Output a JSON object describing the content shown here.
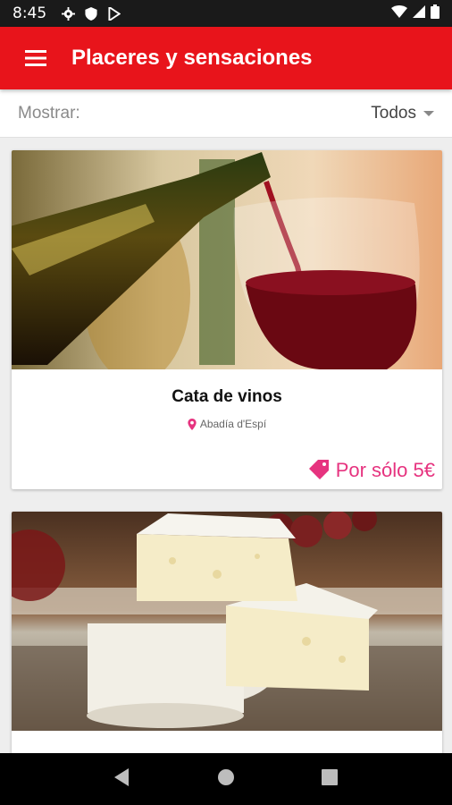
{
  "status_bar": {
    "time": "8:45"
  },
  "app_bar": {
    "title": "Placeres y sensaciones"
  },
  "filter": {
    "label": "Mostrar:",
    "selected": "Todos"
  },
  "cards": [
    {
      "title": "Cata de vinos",
      "location": "Abadía d'Espí",
      "price": "Por sólo 5€",
      "image": "wine-pouring-photo"
    },
    {
      "title": "",
      "location": "",
      "price": "",
      "image": "camembert-cheese-photo"
    }
  ],
  "colors": {
    "primary": "#e8141b",
    "accent": "#e6337f"
  }
}
